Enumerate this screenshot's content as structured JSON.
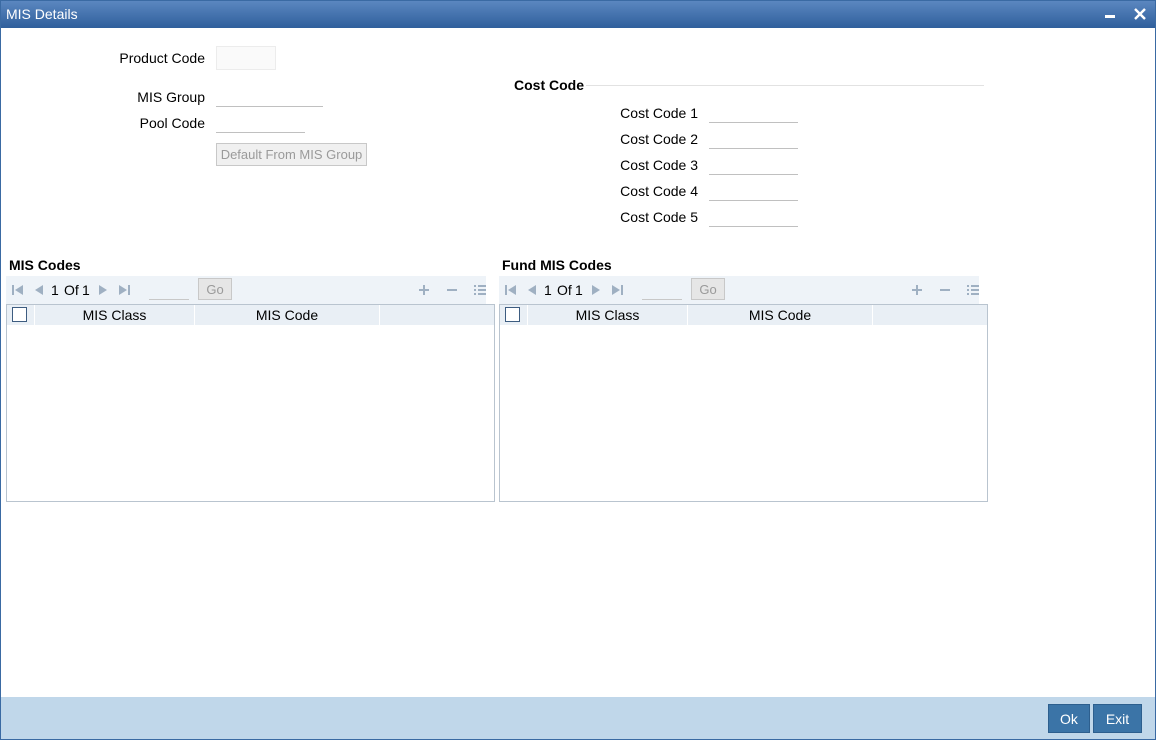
{
  "window": {
    "title": "MIS Details"
  },
  "form": {
    "product_code_label": "Product Code",
    "product_code_value": "",
    "mis_group_label": "MIS Group",
    "mis_group_value": "",
    "pool_code_label": "Pool Code",
    "pool_code_value": "",
    "default_button_label": "Default From MIS Group"
  },
  "cost_code": {
    "title": "Cost Code",
    "fields": [
      {
        "label": "Cost Code 1",
        "value": ""
      },
      {
        "label": "Cost Code 2",
        "value": ""
      },
      {
        "label": "Cost Code 3",
        "value": ""
      },
      {
        "label": "Cost Code 4",
        "value": ""
      },
      {
        "label": "Cost Code 5",
        "value": ""
      }
    ]
  },
  "mis_codes": {
    "title": "MIS Codes",
    "page_current": "1",
    "page_of": "Of",
    "page_total": "1",
    "go_label": "Go",
    "columns": [
      "MIS Class",
      "MIS Code"
    ],
    "rows": []
  },
  "fund_mis_codes": {
    "title": "Fund MIS Codes",
    "page_current": "1",
    "page_of": "Of",
    "page_total": "1",
    "go_label": "Go",
    "columns": [
      "MIS Class",
      "MIS Code"
    ],
    "rows": []
  },
  "footer": {
    "ok_label": "Ok",
    "exit_label": "Exit"
  },
  "colors": {
    "titlebar": "#2f5f9c",
    "footer": "#c0d7ea",
    "button": "#3b74a7"
  }
}
